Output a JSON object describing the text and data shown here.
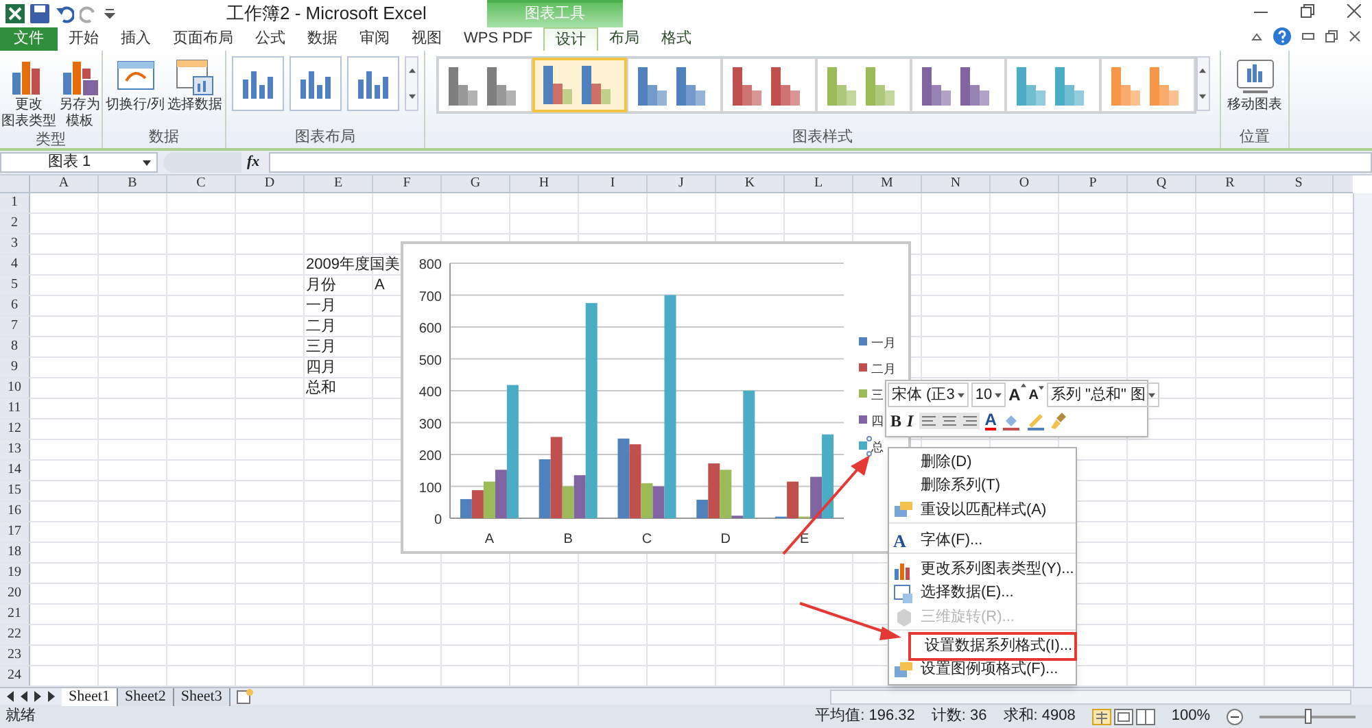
{
  "title_bar": {
    "title": "工作簿2 - Microsoft Excel",
    "context_label": "图表工具"
  },
  "tabs": [
    {
      "label": "文件",
      "kind": "file",
      "selected": false
    },
    {
      "label": "开始",
      "kind": "normal",
      "selected": false
    },
    {
      "label": "插入",
      "kind": "normal",
      "selected": false
    },
    {
      "label": "页面布局",
      "kind": "normal",
      "selected": false
    },
    {
      "label": "公式",
      "kind": "normal",
      "selected": false
    },
    {
      "label": "数据",
      "kind": "normal",
      "selected": false
    },
    {
      "label": "审阅",
      "kind": "normal",
      "selected": false
    },
    {
      "label": "视图",
      "kind": "normal",
      "selected": false
    },
    {
      "label": "WPS PDF",
      "kind": "normal",
      "selected": false
    },
    {
      "label": "设计",
      "kind": "context",
      "selected": true
    },
    {
      "label": "布局",
      "kind": "context",
      "selected": false
    },
    {
      "label": "格式",
      "kind": "context",
      "selected": false
    }
  ],
  "ribbon": {
    "groups": [
      {
        "label": "类型",
        "kind": "buttons",
        "buttons": [
          {
            "kind": "change-type",
            "lines": [
              "更改",
              "图表类型"
            ]
          },
          {
            "kind": "save-template",
            "lines": [
              "另存为",
              "模板"
            ]
          }
        ]
      },
      {
        "label": "数据",
        "kind": "buttons",
        "buttons": [
          {
            "kind": "switch",
            "lines": [
              "切换行/列"
            ]
          },
          {
            "kind": "select-data",
            "lines": [
              "选择数据"
            ]
          }
        ]
      },
      {
        "label": "图表布局",
        "kind": "layouts"
      },
      {
        "label": "图表样式",
        "kind": "styles",
        "styles": [
          {
            "kind": "mono",
            "color": "#7f7f7f",
            "selected": false
          },
          {
            "kind": "multi",
            "selected": true
          },
          {
            "kind": "mono",
            "color": "#4f81bd",
            "selected": false
          },
          {
            "kind": "mono",
            "color": "#c0504d",
            "selected": false
          },
          {
            "kind": "mono",
            "color": "#9bbb59",
            "selected": false
          },
          {
            "kind": "mono",
            "color": "#8064a2",
            "selected": false
          },
          {
            "kind": "mono",
            "color": "#4bacc6",
            "selected": false
          },
          {
            "kind": "mono",
            "color": "#f79646",
            "selected": false
          }
        ]
      },
      {
        "label": "位置",
        "kind": "buttons",
        "buttons": [
          {
            "kind": "move-chart",
            "lines": [
              "移动图表"
            ]
          }
        ]
      }
    ]
  },
  "formula_bar": {
    "name_box": "图表 1",
    "fx": "fx"
  },
  "sheet": {
    "columns": [
      "A",
      "B",
      "C",
      "D",
      "E",
      "F",
      "G",
      "H",
      "I",
      "J",
      "K",
      "L",
      "M",
      "N",
      "O",
      "P",
      "Q",
      "R",
      "S"
    ],
    "rows": [
      {
        "label": "1"
      },
      {
        "label": "2"
      },
      {
        "label": "3"
      },
      {
        "label": "4",
        "cells": [
          {
            "text": "2009年度国美"
          }
        ]
      },
      {
        "label": "5",
        "cells": [
          {
            "text": "月份"
          },
          {
            "text": "A"
          }
        ]
      },
      {
        "label": "6",
        "cells": [
          {
            "text": "一月"
          }
        ]
      },
      {
        "label": "7",
        "cells": [
          {
            "text": "二月"
          }
        ]
      },
      {
        "label": "8",
        "cells": [
          {
            "text": "三月"
          }
        ]
      },
      {
        "label": "9",
        "cells": [
          {
            "text": "四月"
          }
        ]
      },
      {
        "label": "10",
        "cells": [
          {
            "text": "总和"
          }
        ]
      },
      {
        "label": "11"
      },
      {
        "label": "12"
      },
      {
        "label": "13"
      },
      {
        "label": "14"
      },
      {
        "label": "15"
      },
      {
        "label": "16"
      },
      {
        "label": "17"
      },
      {
        "label": "18"
      },
      {
        "label": "19"
      },
      {
        "label": "20"
      },
      {
        "label": "21"
      },
      {
        "label": "22"
      },
      {
        "label": "23"
      },
      {
        "label": "24"
      }
    ]
  },
  "chart": {
    "chart_data": {
      "type": "bar",
      "categories": [
        "A",
        "B",
        "C",
        "D",
        "E"
      ],
      "series": [
        {
          "name": "一月",
          "color": "#4f81bd",
          "values": [
            60,
            185,
            250,
            58,
            5
          ]
        },
        {
          "name": "二月",
          "color": "#c0504d",
          "values": [
            88,
            255,
            232,
            172,
            115
          ]
        },
        {
          "name": "三",
          "color": "#9bbb59",
          "values": [
            115,
            100,
            110,
            152,
            5
          ]
        },
        {
          "name": "四",
          "color": "#8064a2",
          "values": [
            152,
            135,
            100,
            8,
            130
          ]
        },
        {
          "name": "总",
          "color": "#4bacc6",
          "values": [
            418,
            675,
            700,
            400,
            263
          ]
        }
      ],
      "ylim": [
        0,
        800
      ],
      "yticks": [
        0,
        100,
        200,
        300,
        400,
        500,
        600,
        700,
        800
      ],
      "grid": true,
      "legend": "right"
    },
    "legend_entries": [
      {
        "selected": false
      },
      {
        "selected": false
      },
      {
        "selected": false
      },
      {
        "selected": false
      },
      {
        "selected": true
      }
    ]
  },
  "mini_toolbar": {
    "font": "宋体 (正3",
    "size": "10",
    "grow": "A",
    "shrink": "A",
    "element": "系列 \"总和\" 图",
    "bold": "B",
    "italic": "I",
    "font_color": "A"
  },
  "context_menu": {
    "items": [
      {
        "label": "删除(D)",
        "kind": "plain",
        "disabled": false,
        "highlighted": false,
        "divider_after": false
      },
      {
        "label": "删除系列(T)",
        "kind": "plain",
        "disabled": false,
        "highlighted": false,
        "divider_after": false
      },
      {
        "label": "重设以匹配样式(A)",
        "kind": "reset",
        "disabled": false,
        "highlighted": false,
        "divider_after": true
      },
      {
        "label": "字体(F)...",
        "kind": "font",
        "glyph": "A",
        "disabled": false,
        "highlighted": false,
        "divider_after": true
      },
      {
        "label": "更改系列图表类型(Y)...",
        "kind": "chart",
        "disabled": false,
        "highlighted": false,
        "divider_after": false
      },
      {
        "label": "选择数据(E)...",
        "kind": "data",
        "disabled": false,
        "highlighted": false,
        "divider_after": false
      },
      {
        "label": "三维旋转(R)...",
        "kind": "cube",
        "disabled": true,
        "highlighted": false,
        "divider_after": true
      },
      {
        "label": "设置数据系列格式(I)...",
        "kind": "plain",
        "disabled": false,
        "highlighted": true,
        "divider_after": false
      },
      {
        "label": "设置图例项格式(F)...",
        "kind": "reset",
        "disabled": false,
        "highlighted": false,
        "divider_after": false
      }
    ]
  },
  "sheet_tabs": [
    {
      "label": "Sheet1",
      "selected": true
    },
    {
      "label": "Sheet2",
      "selected": false
    },
    {
      "label": "Sheet3",
      "selected": false
    }
  ],
  "status_bar": {
    "mode": "就绪",
    "average": "平均值: 196.32",
    "count": "计数: 36",
    "sum": "求和: 4908",
    "zoom": "100%",
    "zoom_slider": {
      "level": 0.5
    }
  }
}
